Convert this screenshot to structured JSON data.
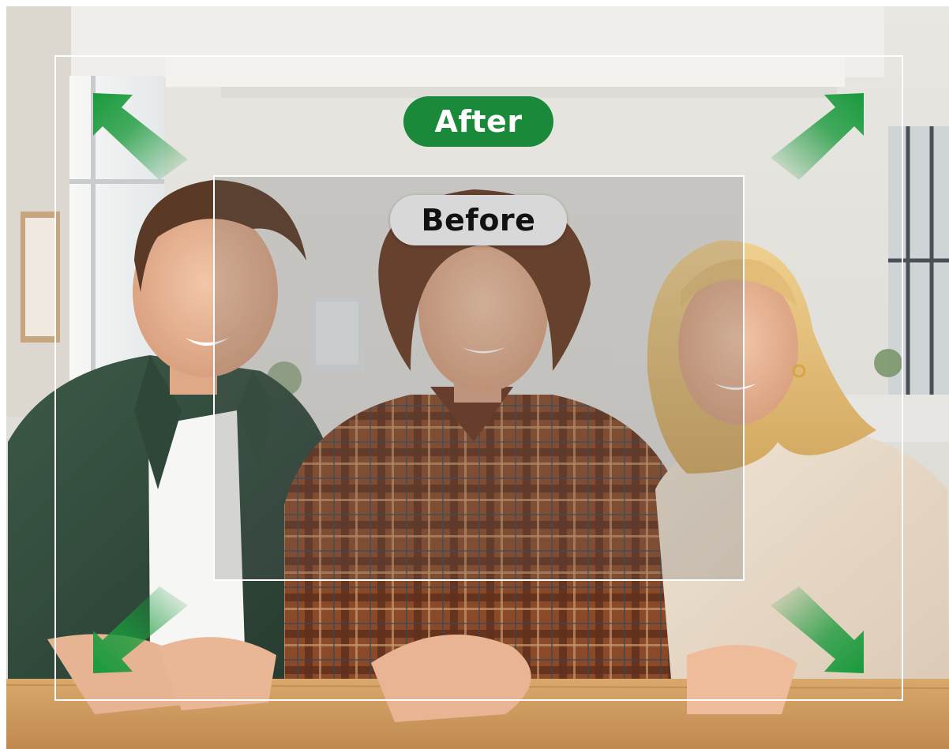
{
  "labels": {
    "after": "After",
    "before": "Before"
  },
  "colors": {
    "after_badge": "#1a8a3a",
    "before_badge": "#d8d8d8",
    "arrow": "#1a9a3c",
    "frame": "#ffffff"
  },
  "icons": [
    "arrow-up-left-icon",
    "arrow-up-right-icon",
    "arrow-down-left-icon",
    "arrow-down-right-icon"
  ]
}
